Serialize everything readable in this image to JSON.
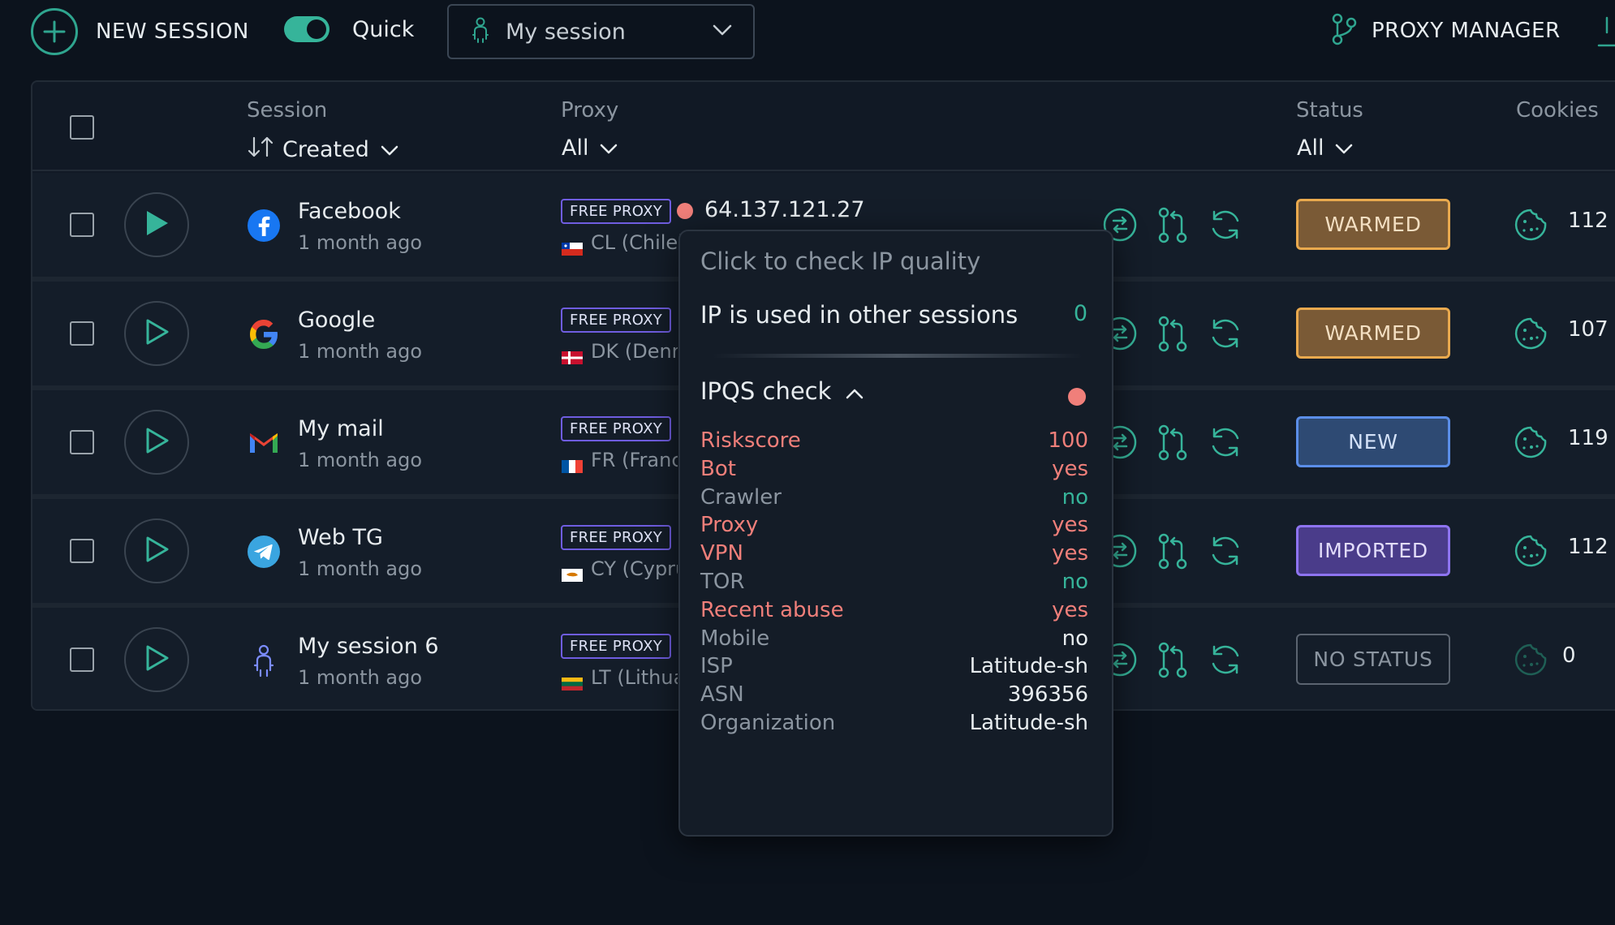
{
  "topbar": {
    "new_session_label": "NEW SESSION",
    "quick_label": "Quick",
    "quick_enabled": true,
    "session_select_value": "My session",
    "proxy_manager_label": "PROXY MANAGER"
  },
  "table": {
    "headers": {
      "session": "Session",
      "session_sort": "Created",
      "proxy": "Proxy",
      "proxy_filter": "All",
      "status": "Status",
      "status_filter": "All",
      "cookies": "Cookies"
    },
    "rows": [
      {
        "service": "Facebook",
        "icon": "facebook-icon",
        "time": "1 month ago",
        "proxy_tag": "FREE PROXY",
        "country": "CL (Chile)",
        "flag": "chile-flag-icon",
        "ip": "64.137.121.27",
        "status": "WARMED",
        "cookies": "112"
      },
      {
        "service": "Google",
        "icon": "google-icon",
        "time": "1 month ago",
        "proxy_tag": "FREE PROXY",
        "country": "DK (Denmark)",
        "flag": "denmark-flag-icon",
        "status": "WARMED",
        "cookies": "107"
      },
      {
        "service": "My mail",
        "icon": "gmail-icon",
        "time": "1 month ago",
        "proxy_tag": "FREE PROXY",
        "country": "FR (France)",
        "flag": "france-flag-icon",
        "status": "NEW",
        "cookies": "119"
      },
      {
        "service": "Web TG",
        "icon": "telegram-icon",
        "time": "1 month ago",
        "proxy_tag": "FREE PROXY",
        "country": "CY (Cyprus)",
        "flag": "cyprus-flag-icon",
        "status": "IMPORTED",
        "cookies": "112"
      },
      {
        "service": "My session 6",
        "icon": "person-icon",
        "time": "1 month ago",
        "proxy_tag": "FREE PROXY",
        "country": "LT (Lithuania)",
        "flag": "lithuania-flag-icon",
        "status": "NO STATUS",
        "cookies": "0"
      }
    ]
  },
  "popup": {
    "hint": "Click to check IP quality",
    "used_label": "IP is used in other sessions",
    "used_value": "0",
    "ipqs_label": "IPQS check",
    "items": [
      {
        "key": "Riskscore",
        "value": "100",
        "flag": "bad"
      },
      {
        "key": "Bot",
        "value": "yes",
        "flag": "bad"
      },
      {
        "key": "Crawler",
        "value": "no",
        "flag": "good"
      },
      {
        "key": "Proxy",
        "value": "yes",
        "flag": "bad"
      },
      {
        "key": "VPN",
        "value": "yes",
        "flag": "bad"
      },
      {
        "key": "TOR",
        "value": "no",
        "flag": "good"
      },
      {
        "key": "Recent abuse",
        "value": "yes",
        "flag": "bad"
      },
      {
        "key": "Mobile",
        "value": "no",
        "flag": "info"
      },
      {
        "key": "ISP",
        "value": "Latitude-sh",
        "flag": "info"
      },
      {
        "key": "ASN",
        "value": "396356",
        "flag": "info"
      },
      {
        "key": "Organization",
        "value": "Latitude-sh",
        "flag": "info"
      }
    ]
  },
  "colors": {
    "accent": "#36b49a",
    "bad": "#f07f7a",
    "muted": "#8b95a0",
    "warmed_bg": "#7a5a36",
    "warmed_border": "#e9a94e",
    "new_bg": "#2e4a73",
    "new_border": "#5b8ee8",
    "imported_bg": "#4a3c8a",
    "imported_border": "#8e74f0",
    "nostatus_border": "#5b6470"
  }
}
